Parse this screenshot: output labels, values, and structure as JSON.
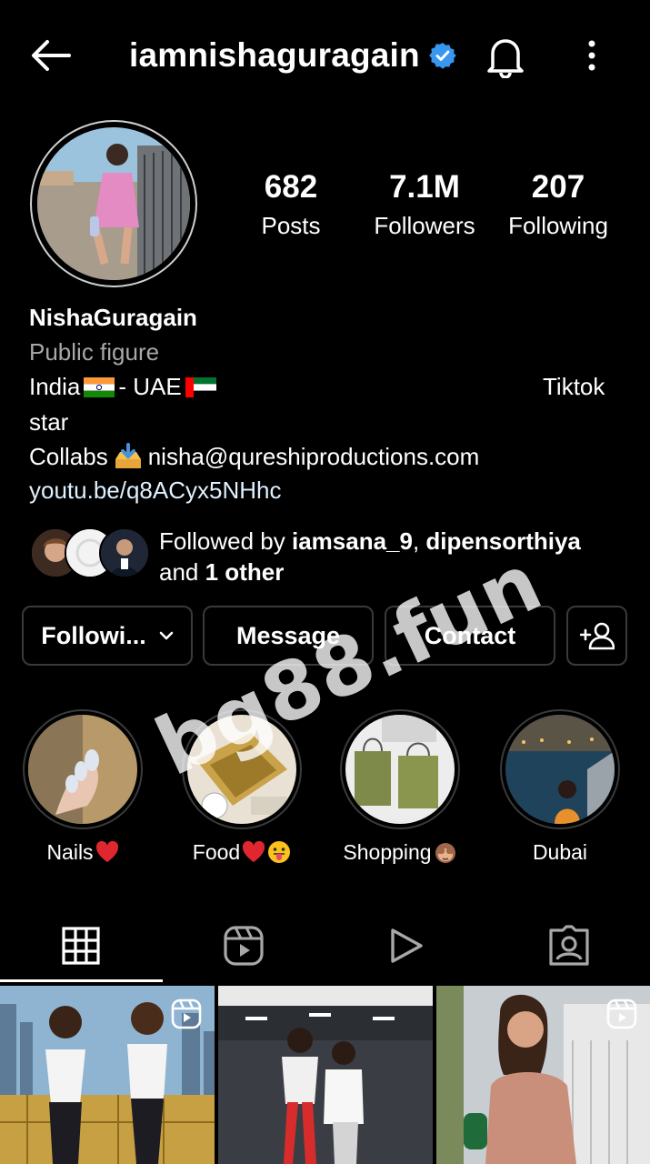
{
  "header": {
    "username": "iamnishaguragain",
    "verified_icon": "verified-badge-icon",
    "back_icon": "back-arrow-icon",
    "bell_icon": "bell-icon",
    "more_icon": "more-vertical-icon"
  },
  "stats": {
    "posts": {
      "value": "682",
      "label": "Posts"
    },
    "followers": {
      "value": "7.1M",
      "label": "Followers"
    },
    "following": {
      "value": "207",
      "label": "Following"
    }
  },
  "bio": {
    "name": "NishaGuragain",
    "category": "Public figure",
    "line1_a": "India",
    "line1_b": "- UAE",
    "line1_right": "Tiktok",
    "line2": "star",
    "line3_a": "Collabs",
    "line3_b": "nisha@qureshiproductions.com",
    "link": "youtu.be/q8ACyx5NHhc"
  },
  "followed_by": {
    "prefix": "Followed by",
    "user1": "iamsana_9",
    "sep": ",",
    "user2": "dipensorthiya",
    "and": "and",
    "others": "1 other"
  },
  "buttons": {
    "following": "Followi...",
    "message": "Message",
    "contact": "Contact"
  },
  "highlights": [
    {
      "label": "Nails"
    },
    {
      "label": "Food"
    },
    {
      "label": "Shopping"
    },
    {
      "label": "Dubai"
    }
  ],
  "tabs": [
    "grid-icon",
    "reels-icon",
    "play-icon",
    "tagged-icon"
  ],
  "watermark": "bg88.fun",
  "colors": {
    "background": "#000000",
    "verified": "#3897f0",
    "secondary_text": "#a8a8a8",
    "button_border": "#3a3a3a"
  }
}
